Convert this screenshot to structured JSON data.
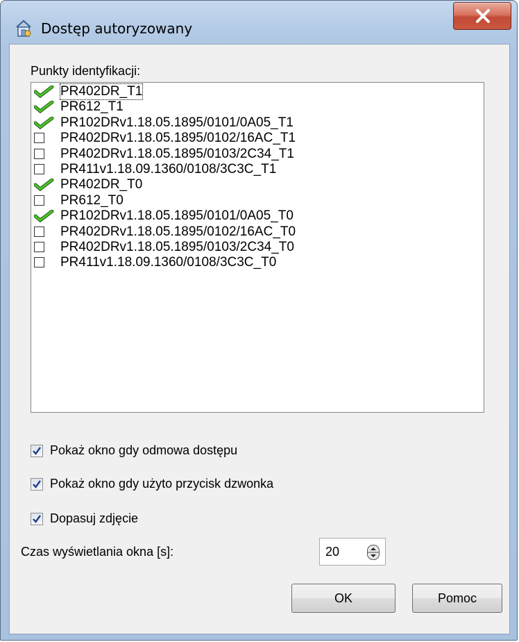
{
  "window": {
    "title": "Dostęp autoryzowany",
    "close_glyph": "X"
  },
  "identification": {
    "label": "Punkty identyfikacji:",
    "items": [
      {
        "name": "PR402DR_T1",
        "checked": true
      },
      {
        "name": "PR612_T1",
        "checked": true
      },
      {
        "name": "PR102DRv1.18.05.1895/0101/0A05_T1",
        "checked": true
      },
      {
        "name": "PR402DRv1.18.05.1895/0102/16AC_T1",
        "checked": false
      },
      {
        "name": "PR402DRv1.18.05.1895/0103/2C34_T1",
        "checked": false
      },
      {
        "name": "PR411v1.18.09.1360/0108/3C3C_T1",
        "checked": false
      },
      {
        "name": "PR402DR_T0",
        "checked": true
      },
      {
        "name": "PR612_T0",
        "checked": false
      },
      {
        "name": "PR102DRv1.18.05.1895/0101/0A05_T0",
        "checked": true
      },
      {
        "name": "PR402DRv1.18.05.1895/0102/16AC_T0",
        "checked": false
      },
      {
        "name": "PR402DRv1.18.05.1895/0103/2C34_T0",
        "checked": false
      },
      {
        "name": "PR411v1.18.09.1360/0108/3C3C_T0",
        "checked": false
      }
    ]
  },
  "options": {
    "show_on_denied": {
      "label": "Pokaż okno gdy odmowa dostępu",
      "checked": true
    },
    "show_on_bell": {
      "label": "Pokaż okno gdy użyto przycisk dzwonka",
      "checked": true
    },
    "fit_photo": {
      "label": "Dopasuj zdjęcie",
      "checked": true
    }
  },
  "display_time": {
    "label": "Czas wyświetlania okna [s]:",
    "value": "20"
  },
  "buttons": {
    "ok": "OK",
    "help": "Pomoc"
  }
}
